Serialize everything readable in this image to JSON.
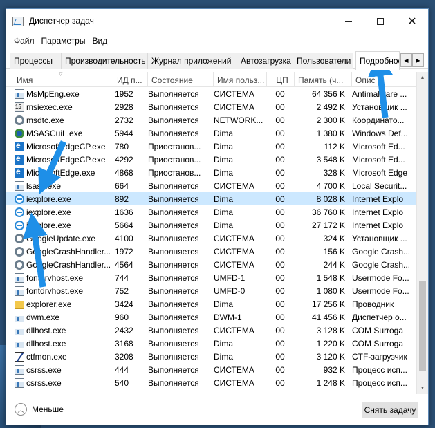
{
  "window": {
    "title": "Диспетчер задач"
  },
  "menu": [
    "Файл",
    "Параметры",
    "Вид"
  ],
  "tabs": [
    "Процессы",
    "Производительность",
    "Журнал приложений",
    "Автозагрузка",
    "Пользователи",
    "Подробнос"
  ],
  "active_tab": "Подробнос",
  "columns": [
    "Имя",
    "ИД п...",
    "Состояние",
    "Имя польз...",
    "ЦП",
    "Память (ч...",
    "Опис"
  ],
  "rows": [
    {
      "name": "MsMpEng.exe",
      "pid": "1952",
      "state": "Выполняется",
      "user": "СИСТЕМА",
      "cpu": "00",
      "mem": "64 356 K",
      "desc": "Antimalware ...",
      "icon": "generic-app-icon"
    },
    {
      "name": "msiexec.exe",
      "pid": "2928",
      "state": "Выполняется",
      "user": "СИСТЕМА",
      "cpu": "00",
      "mem": "2 492 K",
      "desc": "Установщик ...",
      "icon": "installer-icon"
    },
    {
      "name": "msdtc.exe",
      "pid": "2732",
      "state": "Выполняется",
      "user": "NETWORK...",
      "cpu": "00",
      "mem": "2 300 K",
      "desc": "Координато...",
      "icon": "gear-icon"
    },
    {
      "name": "MSASCuiL.exe",
      "pid": "5944",
      "state": "Выполняется",
      "user": "Dima",
      "cpu": "00",
      "mem": "1 380 K",
      "desc": "Windows Def...",
      "icon": "defender-icon"
    },
    {
      "name": "MicrosoftEdgeCP.exe",
      "pid": "780",
      "state": "Приостанов...",
      "user": "Dima",
      "cpu": "00",
      "mem": "112 K",
      "desc": "Microsoft Ed...",
      "icon": "edge-icon"
    },
    {
      "name": "MicrosoftEdgeCP.exe",
      "pid": "4292",
      "state": "Приостанов...",
      "user": "Dima",
      "cpu": "00",
      "mem": "3 548 K",
      "desc": "Microsoft Ed...",
      "icon": "edge-icon"
    },
    {
      "name": "MicrosoftEdge.exe",
      "pid": "4868",
      "state": "Приостанов...",
      "user": "Dima",
      "cpu": "00",
      "mem": "328 K",
      "desc": "Microsoft Edge",
      "icon": "edge-icon"
    },
    {
      "name": "lsass.exe",
      "pid": "664",
      "state": "Выполняется",
      "user": "СИСТЕМА",
      "cpu": "00",
      "mem": "4 700 K",
      "desc": "Local Securit...",
      "icon": "generic-app-icon"
    },
    {
      "name": "iexplore.exe",
      "pid": "892",
      "state": "Выполняется",
      "user": "Dima",
      "cpu": "00",
      "mem": "8 028 K",
      "desc": "Internet Explo",
      "icon": "ie-icon",
      "selected": true
    },
    {
      "name": "iexplore.exe",
      "pid": "1636",
      "state": "Выполняется",
      "user": "Dima",
      "cpu": "00",
      "mem": "36 760 K",
      "desc": "Internet Explo",
      "icon": "ie-icon"
    },
    {
      "name": "iexplore.exe",
      "pid": "5664",
      "state": "Выполняется",
      "user": "Dima",
      "cpu": "00",
      "mem": "27 172 K",
      "desc": "Internet Explo",
      "icon": "ie-icon"
    },
    {
      "name": "GoogleUpdate.exe",
      "pid": "4100",
      "state": "Выполняется",
      "user": "СИСТЕМА",
      "cpu": "00",
      "mem": "324 K",
      "desc": "Установщик ...",
      "icon": "gear-icon"
    },
    {
      "name": "GoogleCrashHandler...",
      "pid": "1972",
      "state": "Выполняется",
      "user": "СИСТЕМА",
      "cpu": "00",
      "mem": "156 K",
      "desc": "Google Crash...",
      "icon": "gear-icon"
    },
    {
      "name": "GoogleCrashHandler...",
      "pid": "4564",
      "state": "Выполняется",
      "user": "СИСТЕМА",
      "cpu": "00",
      "mem": "244 K",
      "desc": "Google Crash...",
      "icon": "gear-icon"
    },
    {
      "name": "fontdrvhost.exe",
      "pid": "744",
      "state": "Выполняется",
      "user": "UMFD-1",
      "cpu": "00",
      "mem": "1 548 K",
      "desc": "Usermode Fo...",
      "icon": "generic-app-icon"
    },
    {
      "name": "fontdrvhost.exe",
      "pid": "752",
      "state": "Выполняется",
      "user": "UMFD-0",
      "cpu": "00",
      "mem": "1 080 K",
      "desc": "Usermode Fo...",
      "icon": "generic-app-icon"
    },
    {
      "name": "explorer.exe",
      "pid": "3424",
      "state": "Выполняется",
      "user": "Dima",
      "cpu": "00",
      "mem": "17 256 K",
      "desc": "Проводник",
      "icon": "folder-icon"
    },
    {
      "name": "dwm.exe",
      "pid": "960",
      "state": "Выполняется",
      "user": "DWM-1",
      "cpu": "00",
      "mem": "41 456 K",
      "desc": "Диспетчер о...",
      "icon": "generic-app-icon"
    },
    {
      "name": "dllhost.exe",
      "pid": "2432",
      "state": "Выполняется",
      "user": "СИСТЕМА",
      "cpu": "00",
      "mem": "3 128 K",
      "desc": "COM Surroga",
      "icon": "generic-app-icon"
    },
    {
      "name": "dllhost.exe",
      "pid": "3168",
      "state": "Выполняется",
      "user": "Dima",
      "cpu": "00",
      "mem": "1 220 K",
      "desc": "COM Surroga",
      "icon": "generic-app-icon"
    },
    {
      "name": "ctfmon.exe",
      "pid": "3208",
      "state": "Выполняется",
      "user": "Dima",
      "cpu": "00",
      "mem": "3 120 K",
      "desc": "CTF-загрузчик",
      "icon": "pen-icon"
    },
    {
      "name": "csrss.exe",
      "pid": "444",
      "state": "Выполняется",
      "user": "СИСТЕМА",
      "cpu": "00",
      "mem": "932 K",
      "desc": "Процесс исп...",
      "icon": "generic-app-icon"
    },
    {
      "name": "csrss.exe",
      "pid": "540",
      "state": "Выполняется",
      "user": "СИСТЕМА",
      "cpu": "00",
      "mem": "1 248 K",
      "desc": "Процесс исп...",
      "icon": "generic-app-icon"
    }
  ],
  "footer": {
    "less_label": "Меньше",
    "end_task_label": "Снять задачу"
  },
  "colors": {
    "accent": "#cce8ff",
    "arrow": "#1e8fe8"
  }
}
